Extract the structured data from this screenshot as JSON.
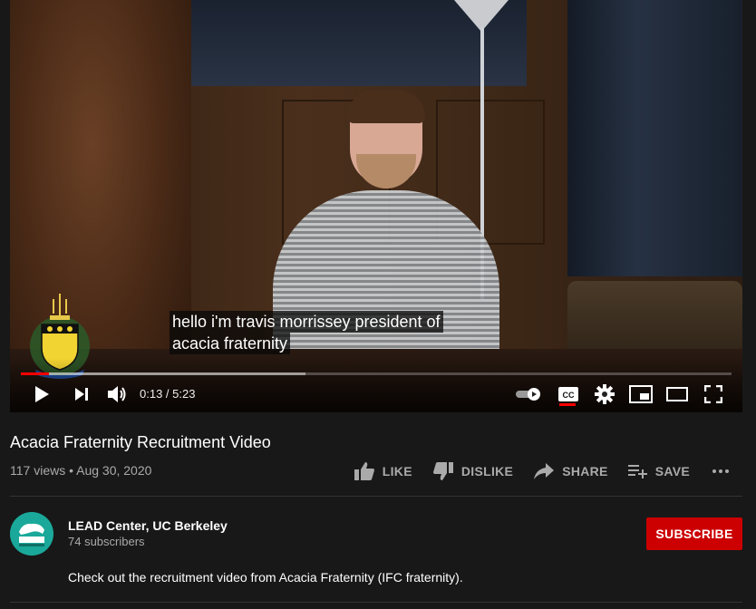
{
  "player": {
    "subtitle_lines": [
      "hello i'm travis morrissey president of",
      "acacia fraternity"
    ],
    "time_current": "0:13",
    "time_total": "5:23",
    "time_display": "0:13 / 5:23",
    "progress_played_fraction": 0.04,
    "progress_loaded_fraction": 0.4,
    "captions_on": true,
    "autoplay_on": true,
    "icons": [
      "play-icon",
      "next-icon",
      "volume-icon",
      "autoplay-toggle-icon",
      "cc-icon",
      "settings-icon",
      "miniplayer-icon",
      "theater-icon",
      "fullscreen-icon"
    ],
    "accent_color": "#ff0000"
  },
  "video": {
    "title": "Acacia Fraternity Recruitment Video",
    "meta": "117 views • Aug 30, 2020"
  },
  "actions": {
    "like": "LIKE",
    "dislike": "DISLIKE",
    "share": "SHARE",
    "save": "SAVE"
  },
  "channel": {
    "name": "LEAD Center, UC Berkeley",
    "subscribers": "74 subscribers",
    "avatar_color": "#1aa89a"
  },
  "subscribe": {
    "label": "SUBSCRIBE",
    "color": "#cc0000"
  },
  "description": "Check out the recruitment video from Acacia Fraternity (IFC fraternity)."
}
